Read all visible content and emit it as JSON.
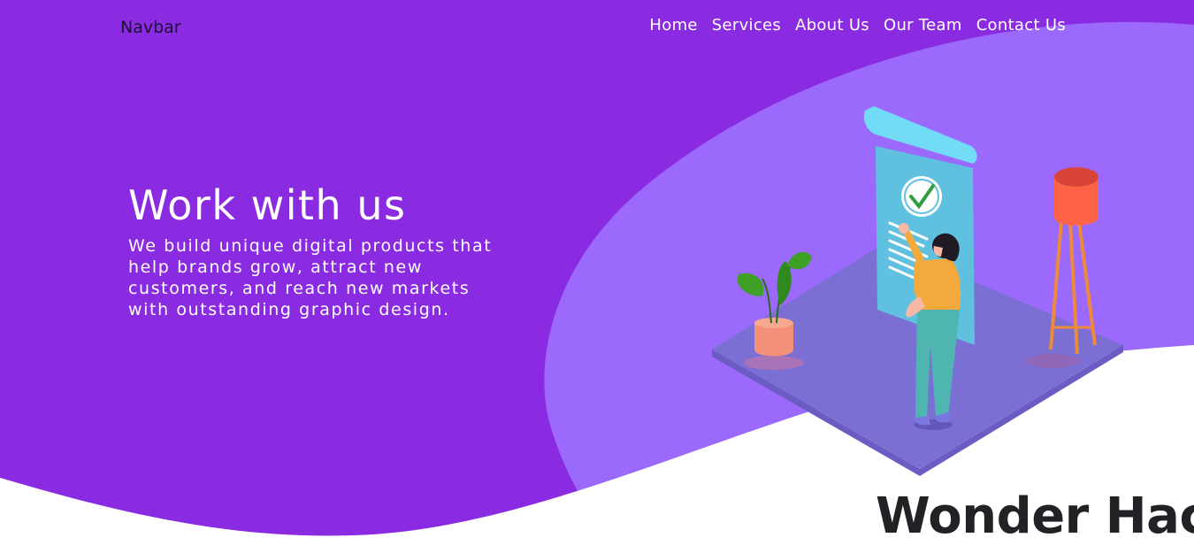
{
  "navbar": {
    "brand": "Navbar",
    "links": [
      {
        "label": "Home"
      },
      {
        "label": "Services"
      },
      {
        "label": "About Us"
      },
      {
        "label": "Our Team"
      },
      {
        "label": "Contact Us"
      }
    ]
  },
  "hero": {
    "title": "Work with us",
    "description": "We build unique digital products that help brands grow, attract new customers, and reach new markets with outstanding graphic design."
  },
  "footer": {
    "title": "Wonder Hack"
  },
  "colors": {
    "primary_purple": "#8a2be2",
    "blob_purple": "#9b69fc",
    "text_white": "#ffffff",
    "heading_dark": "#222226"
  },
  "illustration": {
    "icons": [
      "document-check-icon",
      "plant-icon",
      "floor-lamp-icon",
      "person-icon"
    ]
  }
}
